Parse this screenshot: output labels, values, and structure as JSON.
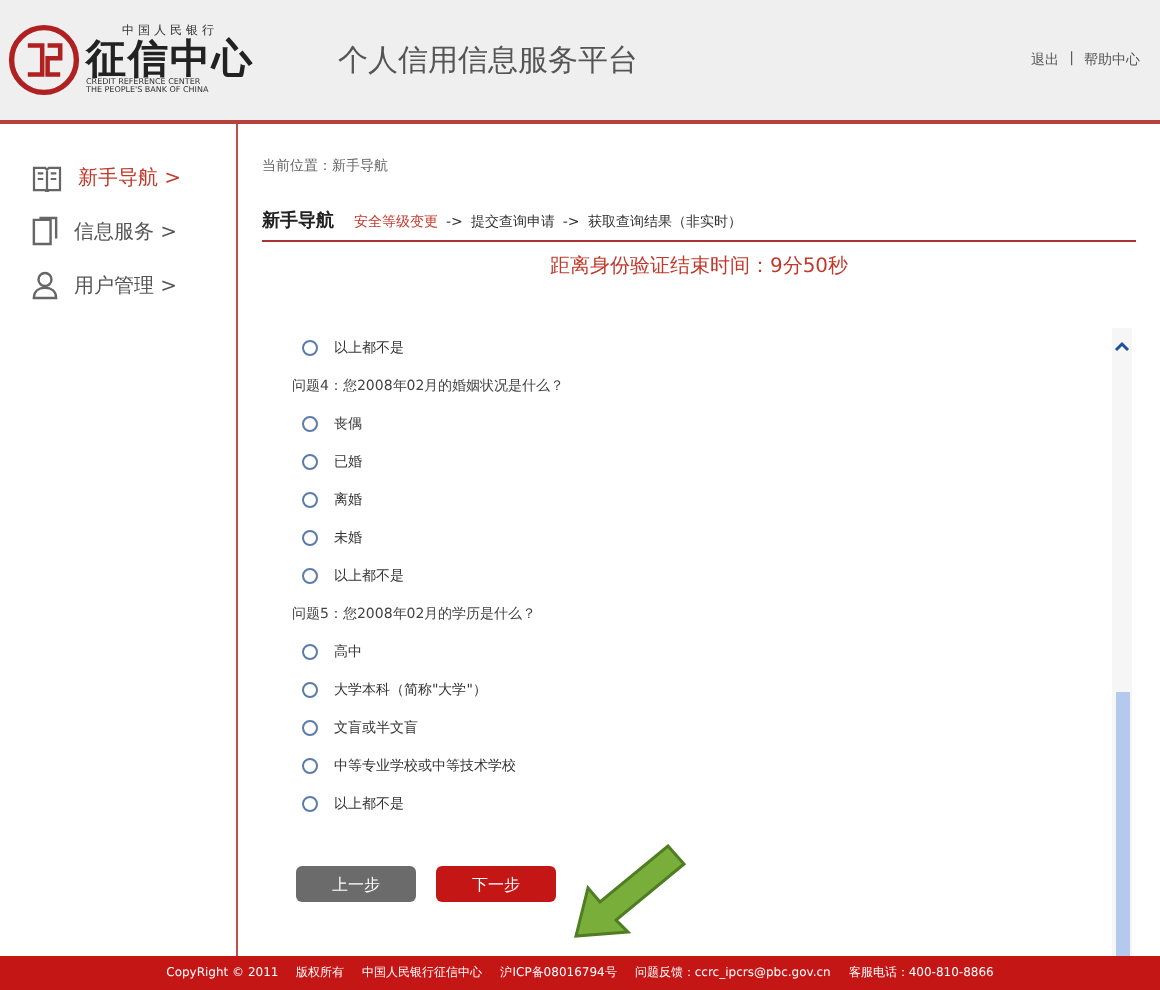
{
  "logo": {
    "top_line": "中国人民银行",
    "name": "征信中心",
    "english_1": "CREDIT REFERENCE CENTER",
    "english_2": "THE PEOPLE'S BANK OF CHINA"
  },
  "platform_title": "个人信用信息服务平台",
  "header_links": [
    "退出",
    "帮助中心"
  ],
  "link_separator": "|",
  "sidebar": {
    "items": [
      {
        "label": "新手导航 >",
        "kind": "book",
        "selected": true
      },
      {
        "label": "信息服务 >",
        "kind": "doc",
        "selected": false
      },
      {
        "label": "用户管理 >",
        "kind": "user",
        "selected": false
      }
    ]
  },
  "breadcrumb": "当前位置：新手导航",
  "section_title": "新手导航",
  "steps": [
    {
      "label": "安全等级变更",
      "selected": true
    },
    {
      "label": "提交查询申请",
      "selected": false
    },
    {
      "label": "获取查询结果（非实时）",
      "selected": false
    }
  ],
  "step_separator": "->",
  "timer": "距离身份验证结束时间：9分50秒",
  "questions": [
    {
      "options": [
        {
          "label": "以上都不是",
          "selected": false
        }
      ]
    },
    {
      "label": "问题4：您2008年02月的婚姻状况是什么？",
      "options": [
        {
          "label": "丧偶",
          "selected": false
        },
        {
          "label": "已婚",
          "selected": false
        },
        {
          "label": "离婚",
          "selected": false
        },
        {
          "label": "未婚",
          "selected": false
        },
        {
          "label": "以上都不是",
          "selected": false
        }
      ]
    },
    {
      "label": "问题5：您2008年02月的学历是什么？",
      "options": [
        {
          "label": "高中",
          "selected": false
        },
        {
          "label": "大学本科（简称\"大学\"）",
          "selected": false
        },
        {
          "label": "文盲或半文盲",
          "selected": false
        },
        {
          "label": "中等专业学校或中等技术学校",
          "selected": false
        },
        {
          "label": "以上都不是",
          "selected": false
        }
      ]
    }
  ],
  "buttons": [
    {
      "label": "上一步",
      "kind": "secondary"
    },
    {
      "label": "下一步",
      "kind": "primary"
    }
  ],
  "footer": [
    "CopyRight © 2011",
    "版权所有",
    "中国人民银行征信中心",
    "沪ICP备08016794号",
    "问题反馈：ccrc_ipcrs@pbc.gov.cn",
    "客服电话：400-810-8866"
  ]
}
